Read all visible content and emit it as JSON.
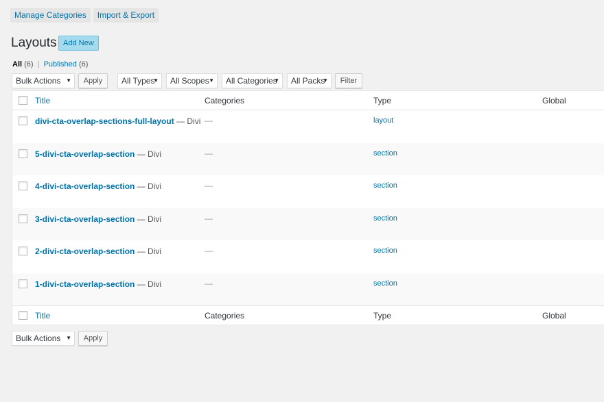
{
  "tabs": [
    "Manage Categories",
    "Import & Export"
  ],
  "page_title": "Layouts",
  "add_new_label": "Add New",
  "views": {
    "all_label": "All",
    "all_count": "(6)",
    "separator": "|",
    "published_label": "Published",
    "published_count": "(6)"
  },
  "filters": {
    "bulk_actions": "Bulk Actions",
    "apply_label": "Apply",
    "types": "All Types",
    "scopes": "All Scopes",
    "categories": "All Categories",
    "packs": "All Packs",
    "filter_label": "Filter"
  },
  "columns": {
    "title": "Title",
    "categories": "Categories",
    "type": "Type",
    "global": "Global"
  },
  "rows": [
    {
      "title": "divi-cta-overlap-sections-full-layout",
      "suffix": " — Divi",
      "categories": "—",
      "type": "layout"
    },
    {
      "title": "5-divi-cta-overlap-section",
      "suffix": " — Divi",
      "categories": "—",
      "type": "section"
    },
    {
      "title": "4-divi-cta-overlap-section",
      "suffix": " — Divi",
      "categories": "—",
      "type": "section"
    },
    {
      "title": "3-divi-cta-overlap-section",
      "suffix": " — Divi",
      "categories": "—",
      "type": "section"
    },
    {
      "title": "2-divi-cta-overlap-section",
      "suffix": " — Divi",
      "categories": "—",
      "type": "section"
    },
    {
      "title": "1-divi-cta-overlap-section",
      "suffix": " — Divi",
      "categories": "—",
      "type": "section"
    }
  ],
  "bottom": {
    "bulk_actions": "Bulk Actions",
    "apply_label": "Apply"
  },
  "icons": {
    "dropdown_caret": "▼"
  },
  "colors": {
    "link": "#0073aa",
    "background": "#f1f1f1",
    "add_new_bg": "#a5dbef"
  }
}
